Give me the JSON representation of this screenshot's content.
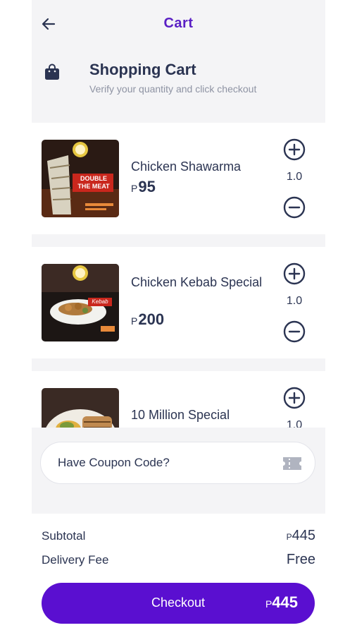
{
  "header": {
    "title": "Cart",
    "section_title": "Shopping Cart",
    "section_subtitle": "Verify your quantity and click checkout"
  },
  "currency_symbol": "P",
  "cart": {
    "items": [
      {
        "name": "Chicken Shawarma",
        "price": "95",
        "quantity": "1.0",
        "image_text": "DOUBLE THE MEAT"
      },
      {
        "name": "Chicken Kebab Special",
        "price": "200",
        "quantity": "1.0",
        "image_text": "Kebab"
      },
      {
        "name": "10 Million Special",
        "price": "",
        "quantity": "1.0",
        "image_text": ""
      }
    ]
  },
  "coupon": {
    "label": "Have Coupon Code?"
  },
  "summary": {
    "subtotal_label": "Subtotal",
    "subtotal_value": "445",
    "delivery_label": "Delivery Fee",
    "delivery_value": "Free"
  },
  "checkout": {
    "label": "Checkout",
    "total": "445"
  },
  "colors": {
    "accent": "#5a0fd0",
    "title": "#5a1fc4",
    "text": "#2b3452",
    "muted": "#8e93a3",
    "background": "#f4f4f6"
  }
}
